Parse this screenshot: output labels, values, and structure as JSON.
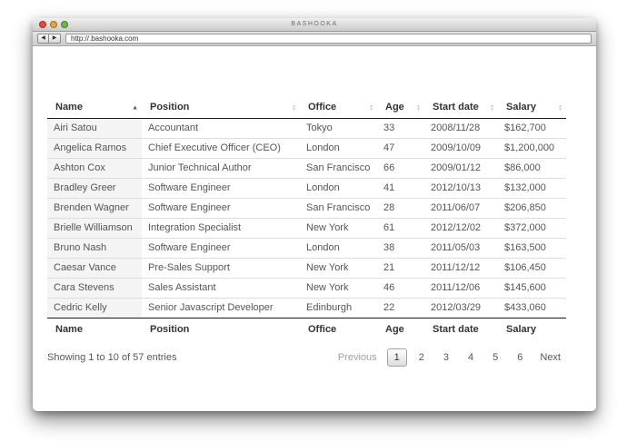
{
  "window": {
    "title": "BASHOOKA",
    "traffic_lights": [
      {
        "name": "close",
        "color": "#e24b41"
      },
      {
        "name": "minimize",
        "color": "#e6a23c"
      },
      {
        "name": "zoom",
        "color": "#6db54c"
      }
    ],
    "toolbar": {
      "back_icon": "◀",
      "forward_icon": "▶",
      "url": "http://.bashooka.com"
    }
  },
  "table": {
    "columns": [
      {
        "label": "Name",
        "sort": "asc"
      },
      {
        "label": "Position",
        "sort": "none"
      },
      {
        "label": "Office",
        "sort": "none"
      },
      {
        "label": "Age",
        "sort": "none"
      },
      {
        "label": "Start date",
        "sort": "none"
      },
      {
        "label": "Salary",
        "sort": "none"
      }
    ],
    "rows": [
      [
        "Airi Satou",
        "Accountant",
        "Tokyo",
        "33",
        "2008/11/28",
        "$162,700"
      ],
      [
        "Angelica Ramos",
        "Chief Executive Officer (CEO)",
        "London",
        "47",
        "2009/10/09",
        "$1,200,000"
      ],
      [
        "Ashton Cox",
        "Junior Technical Author",
        "San Francisco",
        "66",
        "2009/01/12",
        "$86,000"
      ],
      [
        "Bradley Greer",
        "Software Engineer",
        "London",
        "41",
        "2012/10/13",
        "$132,000"
      ],
      [
        "Brenden Wagner",
        "Software Engineer",
        "San Francisco",
        "28",
        "2011/06/07",
        "$206,850"
      ],
      [
        "Brielle Williamson",
        "Integration Specialist",
        "New York",
        "61",
        "2012/12/02",
        "$372,000"
      ],
      [
        "Bruno Nash",
        "Software Engineer",
        "London",
        "38",
        "2011/05/03",
        "$163,500"
      ],
      [
        "Caesar Vance",
        "Pre-Sales Support",
        "New York",
        "21",
        "2011/12/12",
        "$106,450"
      ],
      [
        "Cara Stevens",
        "Sales Assistant",
        "New York",
        "46",
        "2011/12/06",
        "$145,600"
      ],
      [
        "Cedric Kelly",
        "Senior Javascript Developer",
        "Edinburgh",
        "22",
        "2012/03/29",
        "$433,060"
      ]
    ],
    "footer_columns": [
      "Name",
      "Position",
      "Office",
      "Age",
      "Start date",
      "Salary"
    ]
  },
  "pagination": {
    "info": "Showing 1 to 10 of 57 entries",
    "previous_label": "Previous",
    "pages": [
      "1",
      "2",
      "3",
      "4",
      "5",
      "6"
    ],
    "current_page": "1",
    "next_label": "Next"
  },
  "colors": {
    "sort_asc_arrow": "#55558d",
    "sort_inactive_arrow": "#cccccc",
    "header_border": "#1a1a1a",
    "row_border": "#dddddd",
    "sorted_column_bg": "#f4f4f4"
  }
}
